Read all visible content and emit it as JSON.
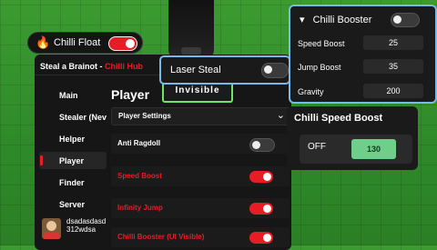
{
  "chilli_float": {
    "label": "Chilli Float",
    "icon": "fire-icon",
    "enabled": true
  },
  "hub": {
    "title_main": "Steal a Brainot - ",
    "title_brand": "Chilli Hub",
    "nav": [
      "Main",
      "Stealer (Nev",
      "Helper",
      "Player",
      "Finder",
      "Server"
    ],
    "active_nav": "Player",
    "profile_name": "dsadasdasd312wdsa",
    "section_title": "Player",
    "invisible_button": "Invisible",
    "dropdown_label": "Player Settings",
    "rows": [
      {
        "label": "Anti Ragdoll",
        "red": false,
        "enabled": false
      },
      {
        "label": "Speed Boost",
        "red": true,
        "enabled": true
      },
      {
        "label": "Infinity Jump",
        "red": true,
        "enabled": true
      },
      {
        "label": "Chilli Booster (UI Visible)",
        "red": true,
        "enabled": true
      }
    ]
  },
  "booster_panel": {
    "title": "Chilli Booster",
    "collapse_glyph": "▾",
    "enabled": false,
    "fields": [
      {
        "label": "Speed Boost",
        "value": "25"
      },
      {
        "label": "Jump Boost",
        "value": "35"
      },
      {
        "label": "Gravity",
        "value": "200"
      }
    ]
  },
  "laser_steal": {
    "label": "Laser Steal",
    "enabled": false
  },
  "speed_panel": {
    "title": "Chilli Speed Boost",
    "status": "OFF",
    "value": "130"
  },
  "colors": {
    "accent": "#e61d25",
    "outline": "#7ab8ea",
    "invisible_border": "#6fe36f",
    "value_green": "#6fcf8a"
  }
}
